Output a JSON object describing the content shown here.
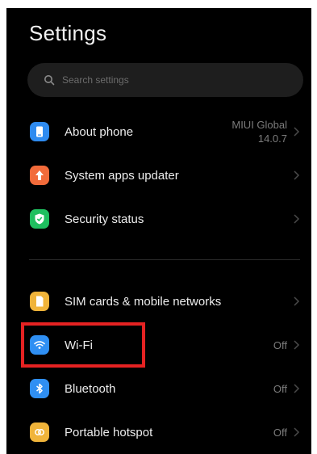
{
  "header": {
    "title": "Settings"
  },
  "search": {
    "placeholder": "Search settings"
  },
  "items": [
    {
      "label": "About phone",
      "value_line1": "MIUI Global",
      "value_line2": "14.0.7",
      "icon": "phone-info-icon",
      "color": "#2e8bf0"
    },
    {
      "label": "System apps updater",
      "value": "",
      "icon": "arrow-up-icon",
      "color": "#f26b3a"
    },
    {
      "label": "Security status",
      "value": "",
      "icon": "shield-check-icon",
      "color": "#1fbf5f"
    },
    {
      "label": "SIM cards & mobile networks",
      "value": "",
      "icon": "sim-card-icon",
      "color": "#f0b43a"
    },
    {
      "label": "Wi-Fi",
      "value": "Off",
      "icon": "wifi-icon",
      "color": "#2f8ff3"
    },
    {
      "label": "Bluetooth",
      "value": "Off",
      "icon": "bluetooth-icon",
      "color": "#2f8ff3"
    },
    {
      "label": "Portable hotspot",
      "value": "Off",
      "icon": "hotspot-icon",
      "color": "#f0b43a"
    }
  ],
  "annotation": {
    "highlight_color": "#e52222"
  }
}
